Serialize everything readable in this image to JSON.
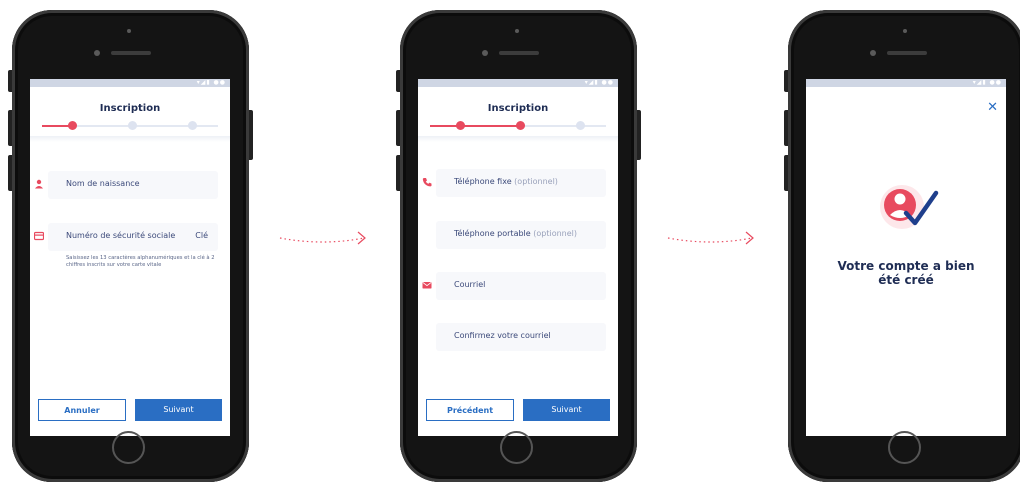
{
  "colors": {
    "accent_red": "#e84a5f",
    "primary_blue": "#2a6ec3",
    "navy": "#1f2d54",
    "inactive": "#dde3f0"
  },
  "screen1": {
    "title": "Inscription",
    "step": 1,
    "fields": {
      "birth_name": {
        "label": "Nom de naissance",
        "icon": "person-icon"
      },
      "ssn": {
        "label": "Numéro de sécurité sociale",
        "key_label": "Clé",
        "icon": "card-icon"
      }
    },
    "help_text": "Saisissez les 13 caractères alphanumériques et la clé à 2 chiffres inscrits sur votre carte vitale",
    "buttons": {
      "cancel": "Annuler",
      "next": "Suivant"
    }
  },
  "screen2": {
    "title": "Inscription",
    "step": 2,
    "fields": {
      "landline": {
        "label": "Téléphone fixe",
        "optional": "(optionnel)",
        "icon": "phone-icon"
      },
      "mobile": {
        "label": "Téléphone portable",
        "optional": "(optionnel)"
      },
      "email": {
        "label": "Courriel",
        "icon": "mail-icon"
      },
      "email_confirm": {
        "label": "Confirmez votre courriel"
      }
    },
    "buttons": {
      "previous": "Précédent",
      "next": "Suivant"
    }
  },
  "screen3": {
    "close_icon": "close-icon",
    "illustration": "account-check-icon",
    "message_line1": "Votre compte a bien",
    "message_line2": "été créé"
  }
}
